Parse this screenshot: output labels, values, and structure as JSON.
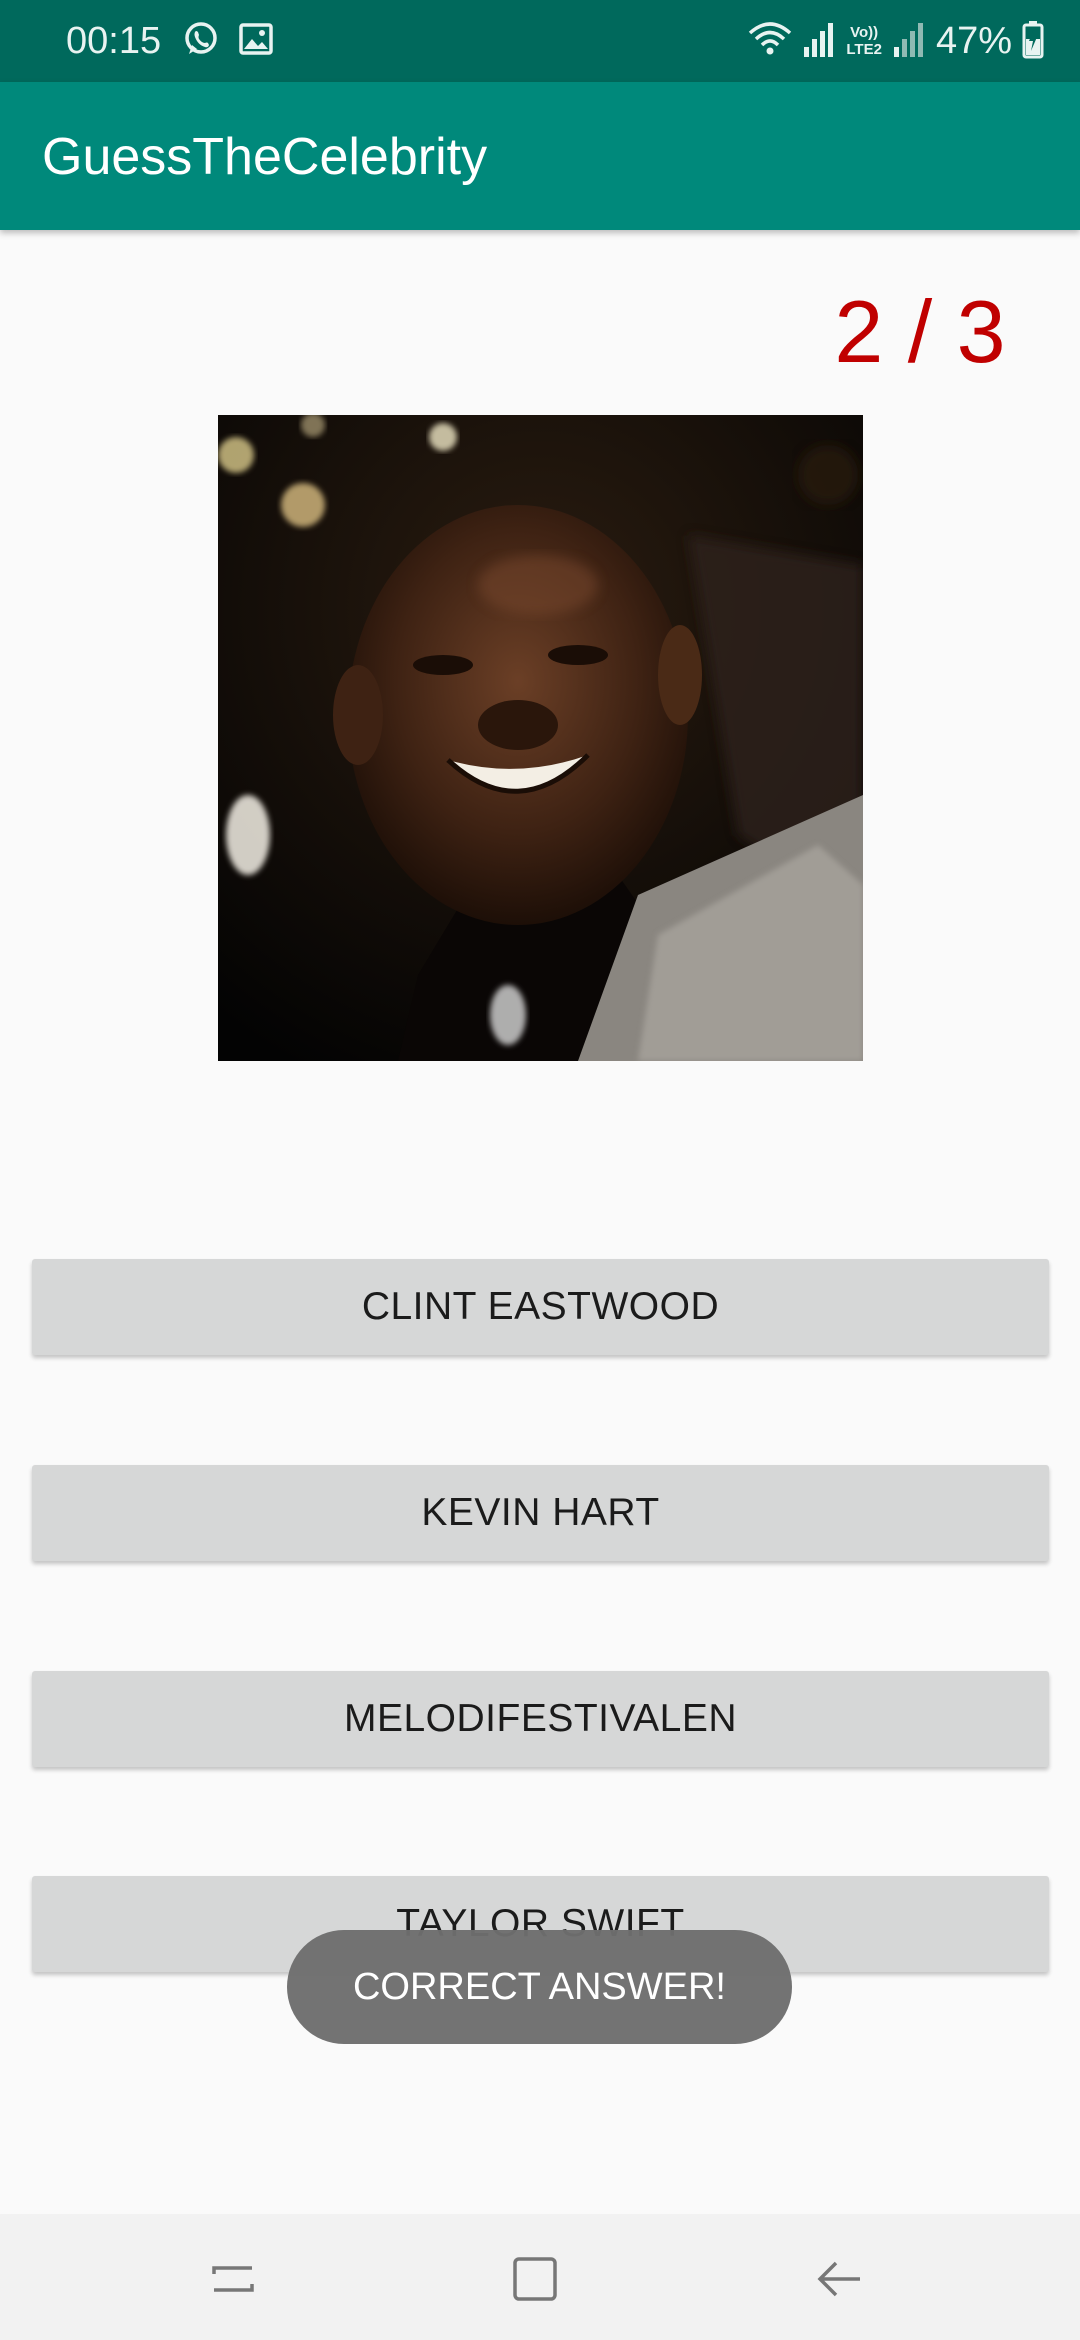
{
  "status_bar": {
    "time": "00:15",
    "left_icons": [
      "whatsapp-icon",
      "gallery-icon"
    ],
    "right_icons": [
      "wifi-icon",
      "signal-icon",
      "volte-icon",
      "signal-icon",
      "battery-icon"
    ],
    "volte_label": "Vo))",
    "lte_label": "LTE2",
    "battery": "47%"
  },
  "app_bar": {
    "title": "GuessTheCelebrity"
  },
  "quiz": {
    "counter": "2 / 3",
    "counter_color": "#c00000",
    "answers": [
      "CLINT EASTWOOD",
      "KEVIN HART",
      "MELODIFESTIVALEN",
      "TAYLOR SWIFT"
    ]
  },
  "toast": {
    "message": "CORRECT ANSWER!"
  },
  "nav_bar": {
    "buttons": [
      "recent-apps-icon",
      "home-icon",
      "back-icon"
    ]
  },
  "colors": {
    "status_bar": "#00695c",
    "app_bar": "#00897b",
    "background": "#fafafa",
    "button": "#d6d7d7",
    "toast": "#6e6e6e"
  }
}
